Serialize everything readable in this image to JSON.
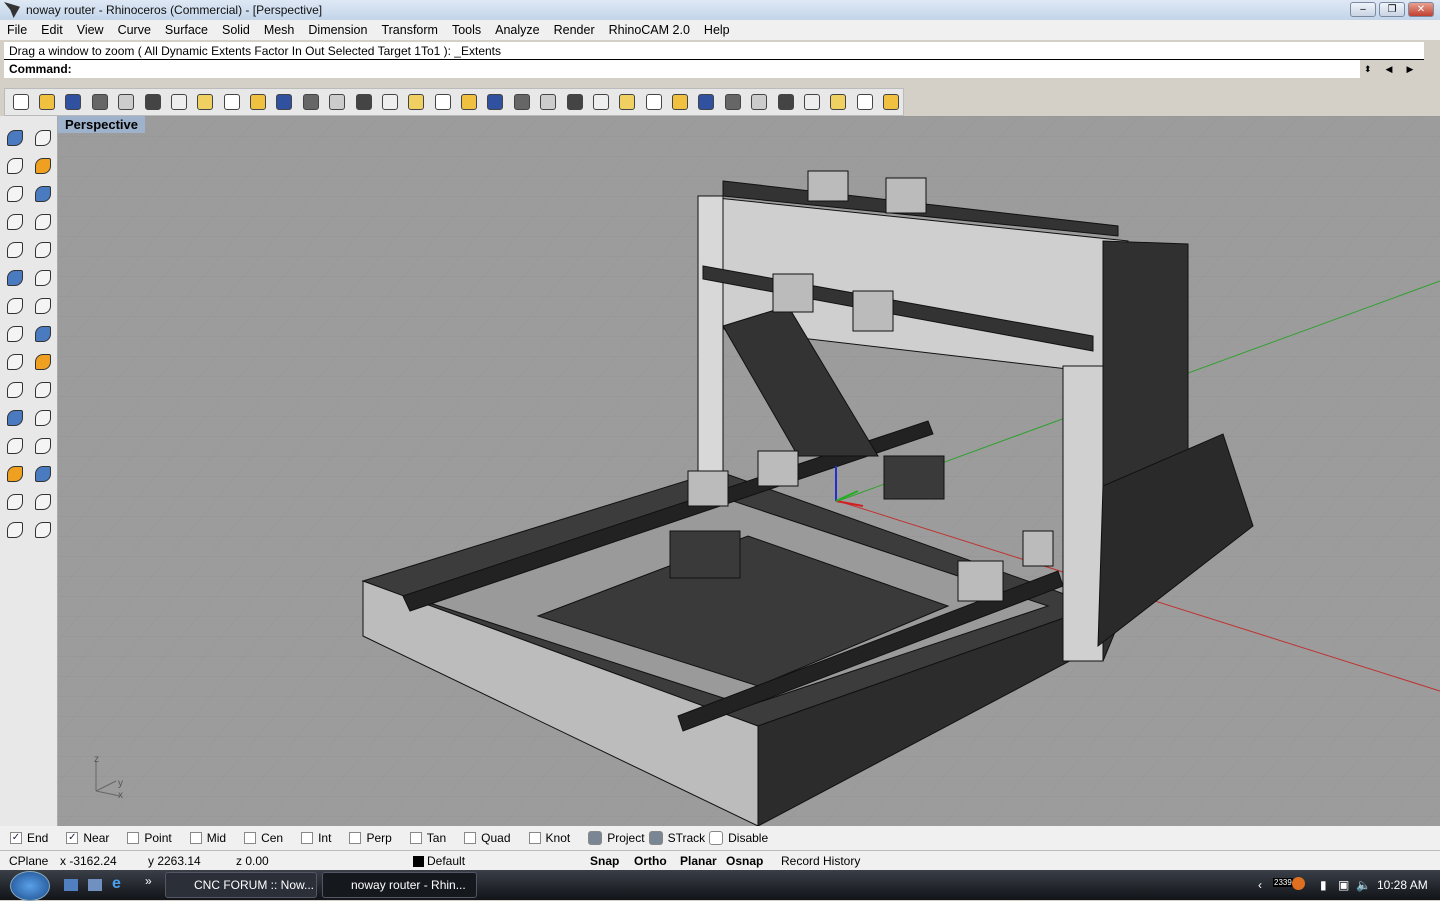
{
  "window": {
    "title": "noway router - Rhinoceros (Commercial) - [Perspective]",
    "min": "–",
    "max": "❐",
    "close": "✕"
  },
  "menu": [
    "File",
    "Edit",
    "View",
    "Curve",
    "Surface",
    "Solid",
    "Mesh",
    "Dimension",
    "Transform",
    "Tools",
    "Analyze",
    "Render",
    "RhinoCAM 2.0",
    "Help"
  ],
  "command": {
    "history": "Drag a window to zoom ( All  Dynamic  Extents  Factor  In  Out  Selected  Target  1To1 ): _Extents",
    "prompt": "Command:"
  },
  "toolbar_icons": [
    "new-file",
    "open",
    "save",
    "print",
    "import",
    "cut",
    "copy",
    "paste",
    "undo",
    "pan-hand",
    "rotate",
    "zoom-in",
    "zoom-window",
    "zoom-extents",
    "zoom-selected",
    "rotate-view",
    "four-viewports",
    "car",
    "grid",
    "cplane",
    "snap",
    "light",
    "lightbulb",
    "lock",
    "layers",
    "color-wheel",
    "wireframe",
    "shaded",
    "rendered",
    "sphere",
    "filter",
    "settings",
    "options",
    "help"
  ],
  "left_toolbar_icons": [
    "select",
    "point",
    "polyline",
    "curve",
    "circle",
    "ellipse",
    "arc",
    "rectangle",
    "polygon",
    "fillet",
    "surface",
    "extrude",
    "box",
    "boolean",
    "cylinder",
    "plane",
    "explode",
    "trim",
    "split",
    "join",
    "move",
    "copy",
    "rotate",
    "scale",
    "text",
    "array",
    "group",
    "dimension",
    "solid",
    "hatch"
  ],
  "viewport": {
    "label": "Perspective",
    "axis_x": "x",
    "axis_y": "y",
    "axis_z": "z",
    "colors": {
      "x_axis": "#c03030",
      "y_axis": "#30a030",
      "background": "#9c9c9c"
    }
  },
  "osnap": [
    {
      "label": "End",
      "checked": true
    },
    {
      "label": "Near",
      "checked": true
    },
    {
      "label": "Point",
      "checked": false
    },
    {
      "label": "Mid",
      "checked": false
    },
    {
      "label": "Cen",
      "checked": false
    },
    {
      "label": "Int",
      "checked": false
    },
    {
      "label": "Perp",
      "checked": false
    },
    {
      "label": "Tan",
      "checked": false
    },
    {
      "label": "Quad",
      "checked": false
    },
    {
      "label": "Knot",
      "checked": false
    }
  ],
  "toggles": [
    {
      "label": "Project",
      "on": true
    },
    {
      "label": "STrack",
      "on": true
    },
    {
      "label": "Disable",
      "on": false
    }
  ],
  "status": {
    "cplane": "CPlane",
    "x": "x -3162.24",
    "y": "y 2263.14",
    "z": "z 0.00",
    "layer": "Default",
    "snap": "Snap",
    "ortho": "Ortho",
    "planar": "Planar",
    "osnap": "Osnap",
    "history": "Record History"
  },
  "taskbar": {
    "tasks": [
      "CNC FORUM :: Now...",
      "noway router - Rhin..."
    ],
    "more": "»",
    "clock": "10:28 AM",
    "tray_badge": "2339"
  }
}
